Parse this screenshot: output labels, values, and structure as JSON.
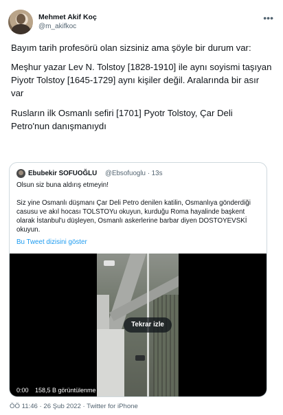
{
  "author": {
    "name": "Mehmet Akif Koç",
    "handle": "@m_akifkoc"
  },
  "more_menu_icon": "more-horizontal-icon",
  "tweet_text": {
    "p1": "Bayım tarih profesörü olan sizsiniz ama şöyle bir durum var:",
    "p2": "Meşhur yazar Lev N. Tolstoy [1828-1910] ile aynı soyismi taşıyan Piyotr Tolstoy [1645-1729] aynı kişiler değil. Aralarında bir asır var",
    "p3": "Rusların ilk Osmanlı sefiri [1701] Pyotr Tolstoy, Çar Deli Petro'nun danışmanıydı"
  },
  "quoted": {
    "name": "Ebubekir SOFUOĞLU",
    "handle_time": "@Ebsofuoglu · 13s",
    "line1": "Olsun siz buna aldırış etmeyin!",
    "paragraph": "Siz yine Osmanlı düşmanı Çar Deli Petro denilen katilin, Osmanlıya gönderdiği casusu ve akıl hocası TOLSTOYu okuyun, kurduğu Roma hayalinde başkent olarak İstanbul'u düşleyen, Osmanlı askerlerine barbar diyen  DOSTOYEVSKİ okuyun.",
    "thread_link": "Bu Tweet dizisini göster",
    "video": {
      "replay_label": "Tekrar izle",
      "time": "0:00",
      "views": "158,5 B görüntülenme"
    }
  },
  "meta": "ÖÖ 11:46 · 26 Şub 2022 · Twitter for iPhone"
}
